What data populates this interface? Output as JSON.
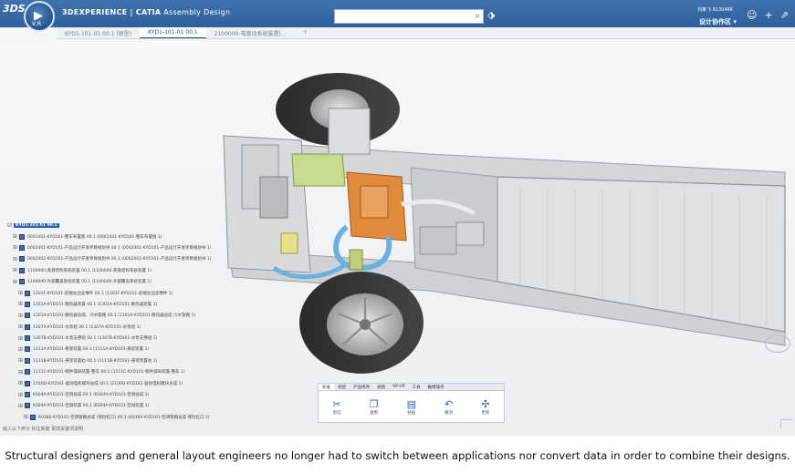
{
  "app": {
    "logo": "3DS",
    "compass_label": "V,R",
    "title_brand": "3DEXPERIENCE | CATIA",
    "title_app": "Assembly Design",
    "search_placeholder": "",
    "user_name": "刘某飞 6130466",
    "workspace": "设计协作区 ▾"
  },
  "tabs": [
    {
      "label": "KYD1-101-01 00.1 (原型)",
      "active": false
    },
    {
      "label": "KYD1-101-01 00.1",
      "active": true
    },
    {
      "label": "2100000-电驱动系统装置(…",
      "active": false
    },
    {
      "label": "+",
      "active": false
    }
  ],
  "tree": {
    "root": "KYD1-101-01 00.1",
    "items": [
      {
        "label": "0001001-KYD101-整车布置图 00.1 (0001001-KYD101-整车布置图 1)",
        "level": 1
      },
      {
        "label": "0002001-KYD101-产品设计开发项目规划书 00.1 (0002001-KYD101-产品设计开发项目规划书 1)",
        "level": 1
      },
      {
        "label": "0002002-KYD101-产品设计开发项目规划书 00.1 (0002002-KYD101-产品设计开发项目规划书 1)",
        "level": 1
      },
      {
        "label": "1100000-底盘结构系统装置 00.1 (1100000-底盘结构系统装置 1)",
        "level": 1
      },
      {
        "label": "1100000-外部覆盖系统装置 00.1 (1100000-外部覆盖系统装置 1)",
        "level": 1
      },
      {
        "label": "1301F-KYD101-前端左边支撑件 00.1 (1301F-KYD101-前端左边支撑件 1)",
        "level": 2
      },
      {
        "label": "1301A-KYD101-散热器装置 00.1 (1301A-KYD101-散热器装置 1)",
        "level": 2
      },
      {
        "label": "1301A-KYD101-散热器总成、冷水管路 00.1 (1301A-KYD101-散热器总成 冷水管路 1)",
        "level": 2
      },
      {
        "label": "1307A-KYD101-水泵组 00.1 (1307A-KYD101-水泵组 1)",
        "level": 2
      },
      {
        "label": "1307B-KYD101-水泵支撑组 00.1 (1307B-KYD101-水泵支撑组 1)",
        "level": 2
      },
      {
        "label": "1111A-KYD101-悬架装置 00.1 (1111A-KYD101-悬架装置 1)",
        "level": 2
      },
      {
        "label": "1111B-KYD101-悬架装置右 00.1 (1111B-KYD101-悬架装置右 1)",
        "level": 2
      },
      {
        "label": "1111C-KYD101-物件操纵装置-整车 00.1 (1111C-KYD101-物件操纵装置-整车 1)",
        "level": 2
      },
      {
        "label": "2100D-KYD101-驱动电机模块总成 00.1 (2100D-KYD101-驱动电机模块总成 1)",
        "level": 2
      },
      {
        "label": "KS04A-KYD101-空调总成 00.1 (KS04A-KYD101-空调总成 1)",
        "level": 2
      },
      {
        "label": "KS04A-KYD101-空调装置 00.1 (KS04A-KYD101-空调装置 1)",
        "level": 2
      },
      {
        "label": "K0360-KYD101-空调管路总成 (保险杠口) 00.1 (K0360-KYD101-空调管路总成 保险杠口 1)",
        "level": 3
      }
    ]
  },
  "action_bar": {
    "tabs": [
      "标准",
      "装配",
      "产品修改",
      "视图",
      "AR-VR",
      "工具",
      "触摸操作"
    ],
    "active_tab": 0,
    "actions": [
      {
        "icon": "scissors-icon",
        "glyph": "✂",
        "label": "剪切"
      },
      {
        "icon": "copy-icon",
        "glyph": "❐",
        "label": "复制"
      },
      {
        "icon": "paste-icon",
        "glyph": "▤",
        "label": "粘贴"
      },
      {
        "icon": "undo-icon",
        "glyph": "↶",
        "label": "撤消"
      },
      {
        "icon": "update-icon",
        "glyph": "✣",
        "label": "更新"
      }
    ]
  },
  "status_bar": "输入以下命令   标注新建   更改关键词说明",
  "caption": "Structural designers and general layout engineers no longer had to switch between applications nor convert data in order to combine their designs.",
  "colors": {
    "topbar": "#2d5f9b",
    "accent": "#2b4f86",
    "motor": "#e08a3c"
  }
}
